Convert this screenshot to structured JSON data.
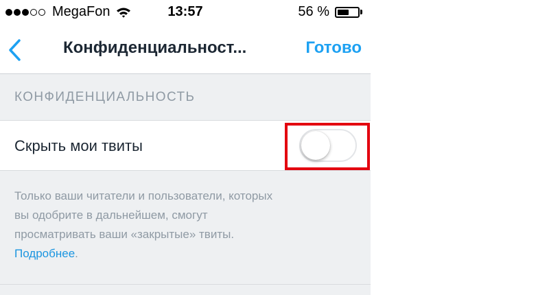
{
  "status_bar": {
    "carrier": "MegaFon",
    "time": "13:57",
    "battery_percent": "56 %",
    "battery_level": 0.56,
    "signal_bars_filled": 3,
    "signal_bars_total": 5
  },
  "nav": {
    "title": "Конфиденциальност...",
    "done_label": "Готово",
    "back_icon": "chevron-left-icon"
  },
  "section": {
    "header": "КОНФИДЕНЦИАЛЬНОСТЬ"
  },
  "row": {
    "label": "Скрыть мои твиты",
    "toggle_on": false
  },
  "footer": {
    "text_line1": "Только ваши читатели и пользователи, которых",
    "text_line2": "вы одобрите в дальнейшем, смогут",
    "text_line3": "просматривать ваши «закрытые» твиты.",
    "link_text": "Подробнее",
    "link_suffix": "."
  },
  "colors": {
    "accent": "#1da1f2",
    "highlight": "#e3000f",
    "grouped_bg": "#eef0f2"
  }
}
